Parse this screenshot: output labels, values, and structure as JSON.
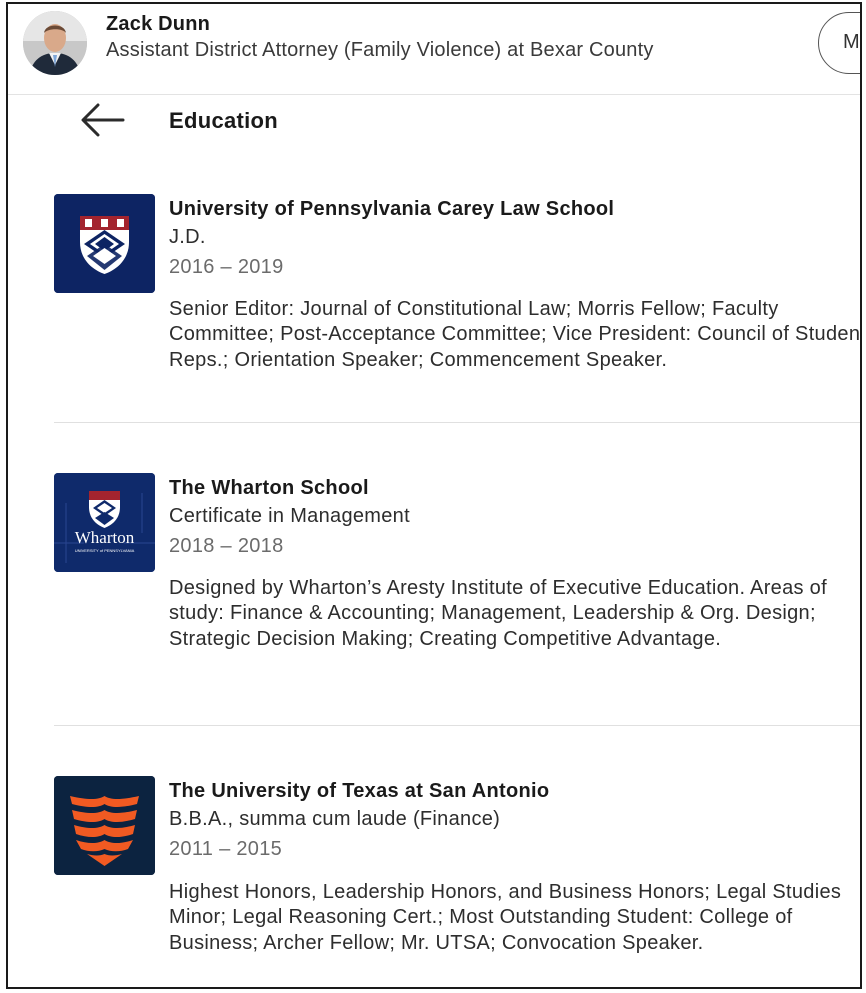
{
  "profile": {
    "name": "Zack Dunn",
    "headline": "Assistant District Attorney (Family Violence) at Bexar County",
    "action_button_label": "M"
  },
  "page": {
    "back_icon": "arrow-left-icon",
    "title": "Education"
  },
  "education": [
    {
      "school": "University of Pennsylvania Carey Law School",
      "degree": "J.D.",
      "dates": "2016 – 2019",
      "description": "Senior Editor: Journal of Constitutional Law; Morris Fellow; Faculty Committee; Post-Acceptance Committee; Vice President: Council of Student Reps.; Orientation Speaker; Commencement Speaker.",
      "logo_icon": "penn-shield-logo",
      "logo_color": "#0d2463"
    },
    {
      "school": "The Wharton School",
      "degree": "Certificate in Management",
      "dates": "2018 – 2018",
      "description": "Designed by Wharton’s Aresty Institute of Executive Education. Areas of study: Finance & Accounting; Management, Leadership & Org. Design; Strategic Decision Making; Creating Competitive Advantage.",
      "logo_icon": "wharton-logo",
      "logo_color": "#0f2a6b",
      "logo_text": "Wharton",
      "logo_subtext": "UNIVERSITY of PENNSYLVANIA"
    },
    {
      "school": "The University of Texas at San Antonio",
      "degree": "B.B.A., summa cum laude (Finance)",
      "dates": "2011 – 2015",
      "description": "Highest Honors, Leadership Honors, and Business Honors; Legal Studies Minor; Legal Reasoning Cert.; Most Outstanding Student: College of Business; Archer Fellow; Mr. UTSA; Convocation Speaker.",
      "logo_icon": "utsa-logo",
      "logo_color": "#0c2340",
      "accent_color": "#f15a22"
    }
  ]
}
